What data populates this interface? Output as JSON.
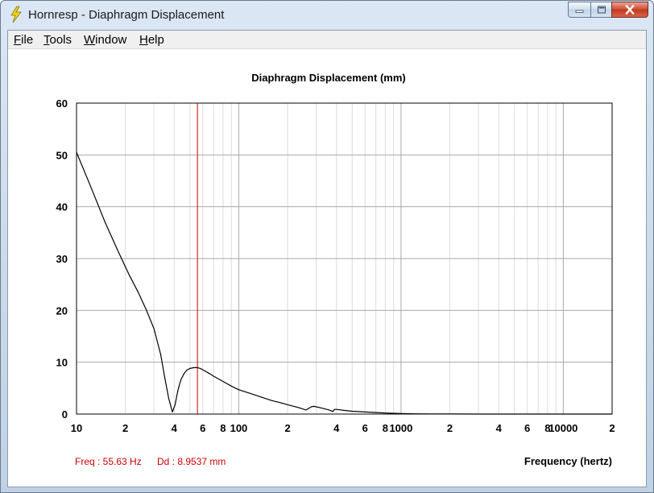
{
  "window": {
    "title": "Hornresp - Diaphragm Displacement",
    "icon": "lightning-bolt-icon"
  },
  "menu": [
    {
      "label": "File",
      "mnemonic": "F",
      "rest": "ile"
    },
    {
      "label": "Tools",
      "mnemonic": "T",
      "rest": "ools"
    },
    {
      "label": "Window",
      "mnemonic": "W",
      "rest": "indow"
    },
    {
      "label": "Help",
      "mnemonic": "H",
      "rest": "elp"
    }
  ],
  "colors": {
    "curve": "#000000",
    "cursor": "#cc0000",
    "readout": "#cc0000",
    "grid_major": "#a8a8a8",
    "grid_minor": "#dcdcdc"
  },
  "readout": {
    "freq": "Freq : 55.63 Hz",
    "dd": "Dd : 8.9537 mm"
  },
  "chart_data": {
    "type": "line",
    "title": "Diaphragm Displacement (mm)",
    "xlabel": "Frequency (hertz)",
    "ylabel": "",
    "x_scale": "log",
    "xlim": [
      10,
      20000
    ],
    "ylim": [
      0,
      60
    ],
    "y_ticks": [
      "0",
      "10",
      "20",
      "30",
      "40",
      "50",
      "60"
    ],
    "y_tick_values": [
      0,
      10,
      20,
      30,
      40,
      50,
      60
    ],
    "x_tick_labels": [
      {
        "value": 10,
        "label": "10"
      },
      {
        "value": 20,
        "label": "2"
      },
      {
        "value": 40,
        "label": "4"
      },
      {
        "value": 60,
        "label": "6"
      },
      {
        "value": 80,
        "label": "8"
      },
      {
        "value": 100,
        "label": "100"
      },
      {
        "value": 200,
        "label": "2"
      },
      {
        "value": 400,
        "label": "4"
      },
      {
        "value": 600,
        "label": "6"
      },
      {
        "value": 800,
        "label": "8"
      },
      {
        "value": 1000,
        "label": "1000"
      },
      {
        "value": 2000,
        "label": "2"
      },
      {
        "value": 4000,
        "label": "4"
      },
      {
        "value": 6000,
        "label": "6"
      },
      {
        "value": 8000,
        "label": "8"
      },
      {
        "value": 10000,
        "label": "10000"
      },
      {
        "value": 20000,
        "label": "2"
      }
    ],
    "grid": true,
    "cursor_x": 55.63,
    "series": [
      {
        "x": [
          10,
          12,
          15,
          18,
          21,
          24,
          27,
          30,
          33,
          35,
          37,
          39,
          40.5,
          41.5,
          42.5,
          44,
          46,
          48,
          50,
          53,
          55.6,
          58,
          62,
          66,
          70,
          80,
          90,
          100,
          120,
          140,
          160,
          180,
          200,
          230,
          260,
          280,
          290,
          300,
          330,
          360,
          380,
          390,
          400,
          450,
          500,
          600,
          700,
          800,
          1000,
          1200,
          1500,
          2000,
          3000,
          5000,
          10000,
          20000
        ],
        "y": [
          50.5,
          44.5,
          37,
          31.5,
          27,
          23.5,
          20,
          16.5,
          11.5,
          7,
          3,
          0.4,
          1.8,
          3.5,
          5,
          6.6,
          7.8,
          8.5,
          8.8,
          8.95,
          8.95,
          8.8,
          8.3,
          7.8,
          7.3,
          6.3,
          5.4,
          4.7,
          3.9,
          3.2,
          2.6,
          2.2,
          1.8,
          1.3,
          0.8,
          1.4,
          1.5,
          1.4,
          1.1,
          0.8,
          0.5,
          0.9,
          0.9,
          0.7,
          0.55,
          0.4,
          0.3,
          0.2,
          0.1,
          0.05,
          0.02,
          0.01,
          0,
          0,
          0,
          0
        ]
      }
    ]
  }
}
